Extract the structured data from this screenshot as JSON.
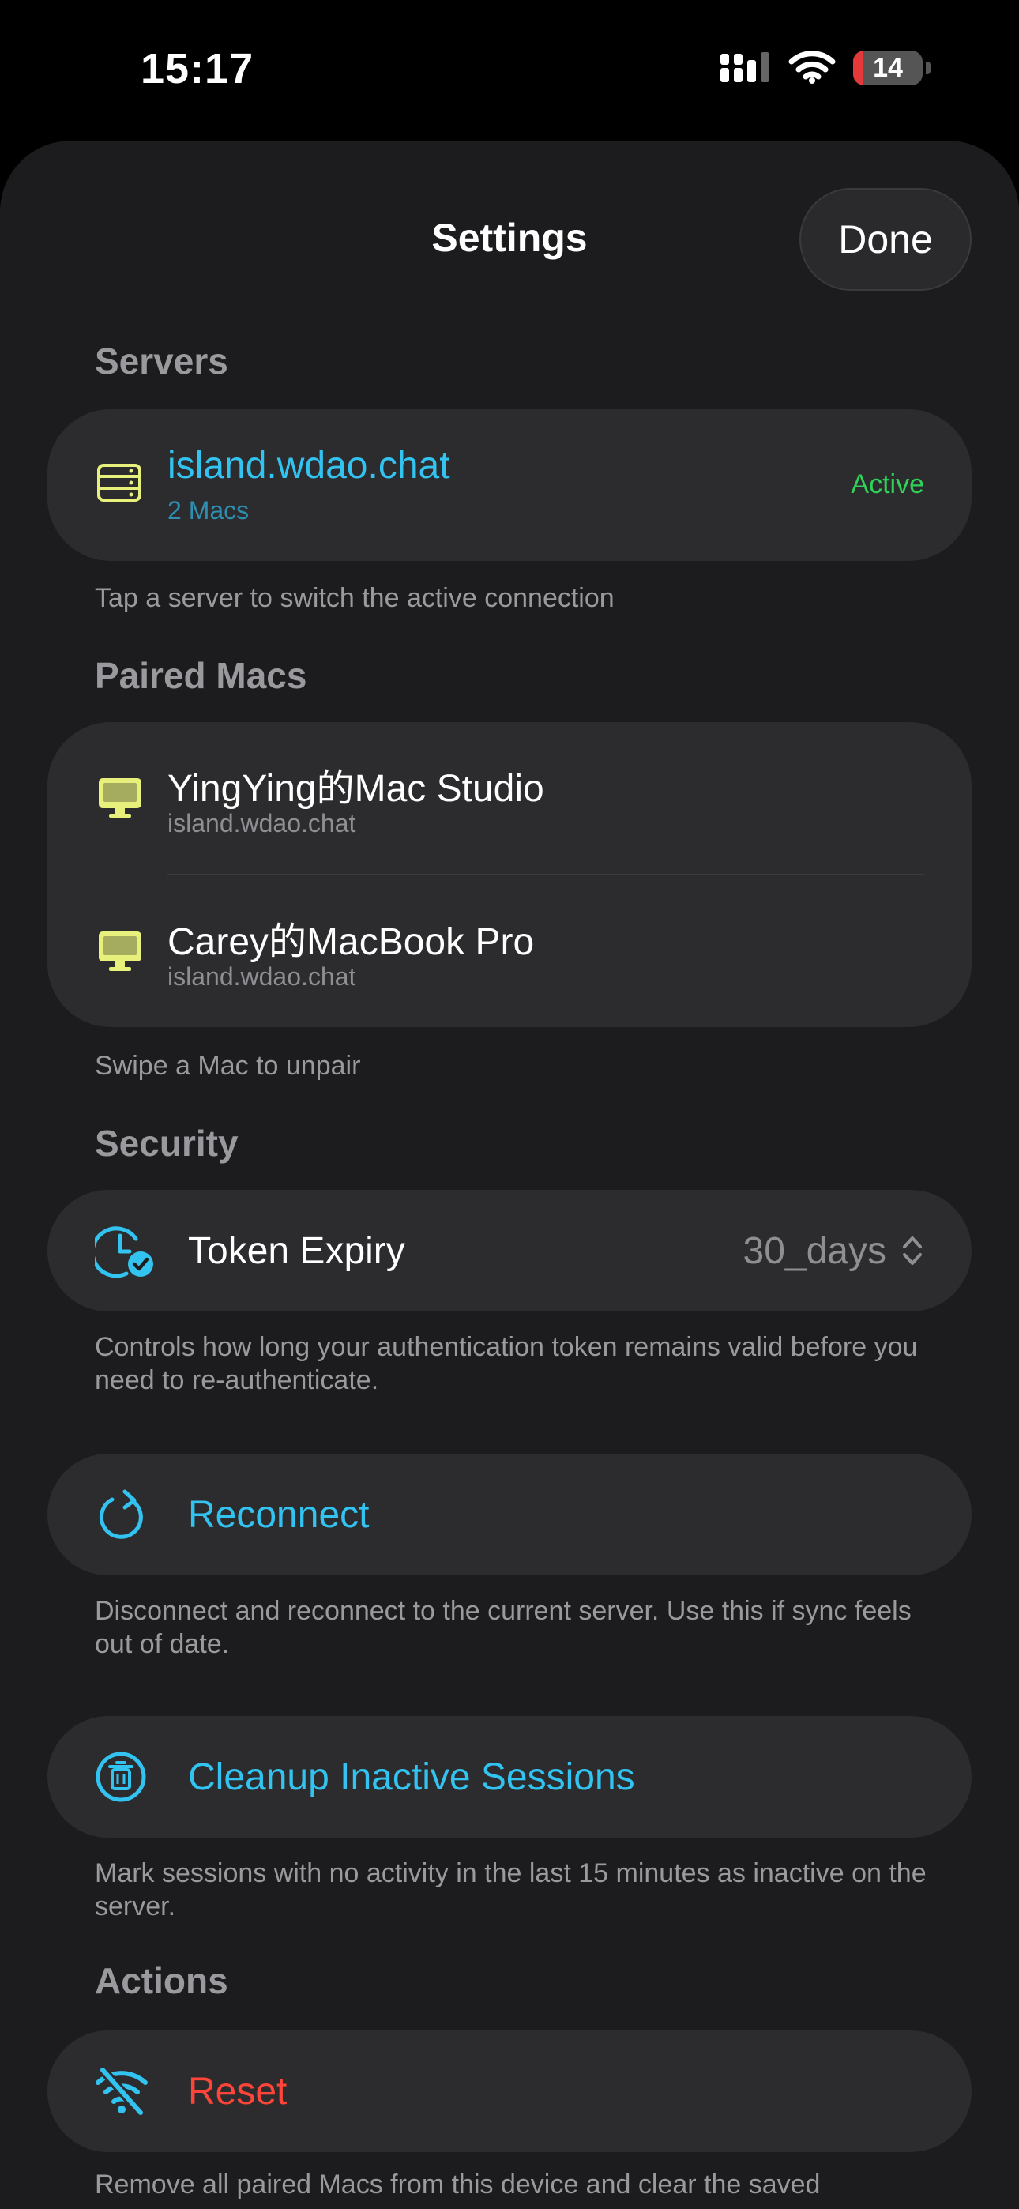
{
  "status_bar": {
    "time": "15:17",
    "battery_level": "14",
    "battery_fraction": 0.14
  },
  "header": {
    "title": "Settings",
    "done_label": "Done"
  },
  "servers": {
    "section_title": "Servers",
    "items": [
      {
        "name": "island.wdao.chat",
        "subtitle": "2 Macs",
        "status": "Active",
        "icon": "server-icon"
      }
    ],
    "footnote": "Tap a server to switch the active connection"
  },
  "paired_macs": {
    "section_title": "Paired Macs",
    "items": [
      {
        "name": "YingYing的Mac Studio",
        "server": "island.wdao.chat",
        "icon": "desktop-icon"
      },
      {
        "name": "Carey的MacBook Pro",
        "server": "island.wdao.chat",
        "icon": "desktop-icon"
      }
    ],
    "footnote": "Swipe a Mac to unpair"
  },
  "security": {
    "section_title": "Security",
    "token_expiry_label": "Token Expiry",
    "token_expiry_value": "30_days",
    "token_footnote": "Controls how long your authentication token remains valid before you need to re-authenticate.",
    "reconnect_label": "Reconnect",
    "reconnect_footnote": "Disconnect and reconnect to the current server. Use this if sync feels out of date.",
    "cleanup_label": "Cleanup Inactive Sessions",
    "cleanup_footnote": "Mark sessions with no activity in the last 15 minutes as inactive on the server."
  },
  "actions": {
    "section_title": "Actions",
    "reset_label": "Reset",
    "reset_footnote": "Remove all paired Macs from this device and clear the saved"
  },
  "colors": {
    "accent": "#32c3f0",
    "active": "#30d158",
    "destructive": "#ff453a",
    "icon_yellow": "#e6f07a"
  }
}
